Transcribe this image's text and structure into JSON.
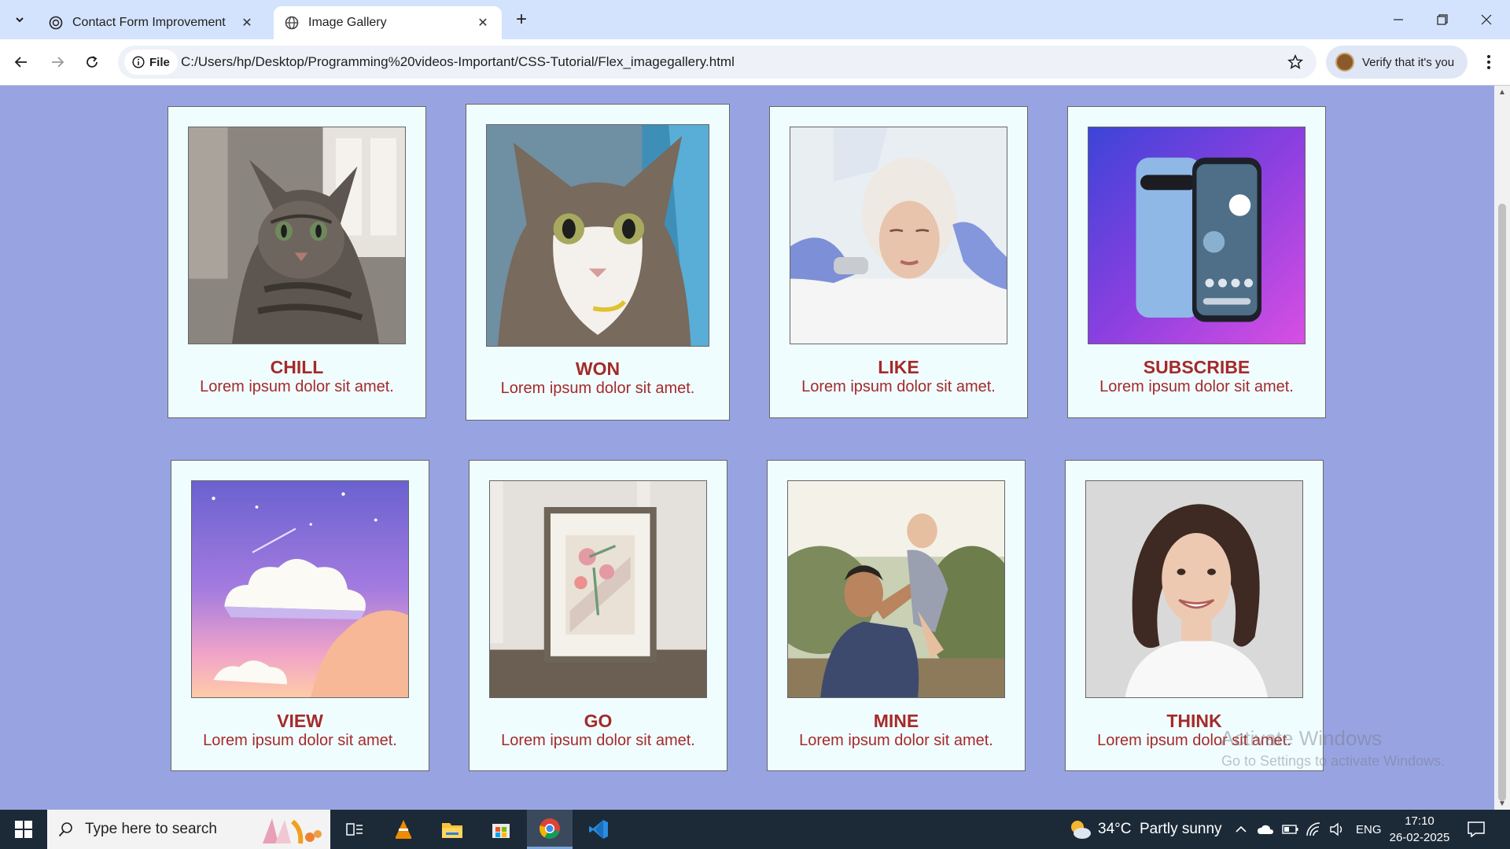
{
  "browser": {
    "tabs": [
      {
        "title": "Contact Form Improvement",
        "active": false
      },
      {
        "title": "Image Gallery",
        "active": true
      }
    ],
    "url_chip": "File",
    "url": "C:/Users/hp/Desktop/Programming%20videos-Important/CSS-Tutorial/Flex_imagegallery.html",
    "profile_label": "Verify that it's you"
  },
  "gallery": {
    "cards": [
      {
        "title": "CHILL",
        "desc": "Lorem ipsum dolor sit amet.",
        "image": "tabby-cat-photo"
      },
      {
        "title": "WON",
        "desc": "Lorem ipsum dolor sit amet.",
        "image": "kitten-closeup-photo"
      },
      {
        "title": "LIKE",
        "desc": "Lorem ipsum dolor sit amet.",
        "image": "facial-treatment-photo"
      },
      {
        "title": "SUBSCRIBE",
        "desc": "Lorem ipsum dolor sit amet.",
        "image": "smartphone-photo"
      },
      {
        "title": "VIEW",
        "desc": "Lorem ipsum dolor sit amet.",
        "image": "pixel-sky-clouds"
      },
      {
        "title": "GO",
        "desc": "Lorem ipsum dolor sit amet.",
        "image": "framed-flower-art-photo"
      },
      {
        "title": "MINE",
        "desc": "Lorem ipsum dolor sit amet.",
        "image": "father-baby-photo"
      },
      {
        "title": "THINK",
        "desc": "Lorem ipsum dolor sit amet.",
        "image": "woman-portrait-photo"
      }
    ],
    "colors": {
      "background": "#98a4e2",
      "card": "#f0fdff",
      "text": "#a52a2a"
    }
  },
  "watermark": {
    "line1": "Activate Windows",
    "line2": "Go to Settings to activate Windows."
  },
  "taskbar": {
    "search_placeholder": "Type here to search",
    "weather": "34°C  Partly sunny",
    "language": "ENG",
    "time": "17:10",
    "date": "26-02-2025"
  }
}
